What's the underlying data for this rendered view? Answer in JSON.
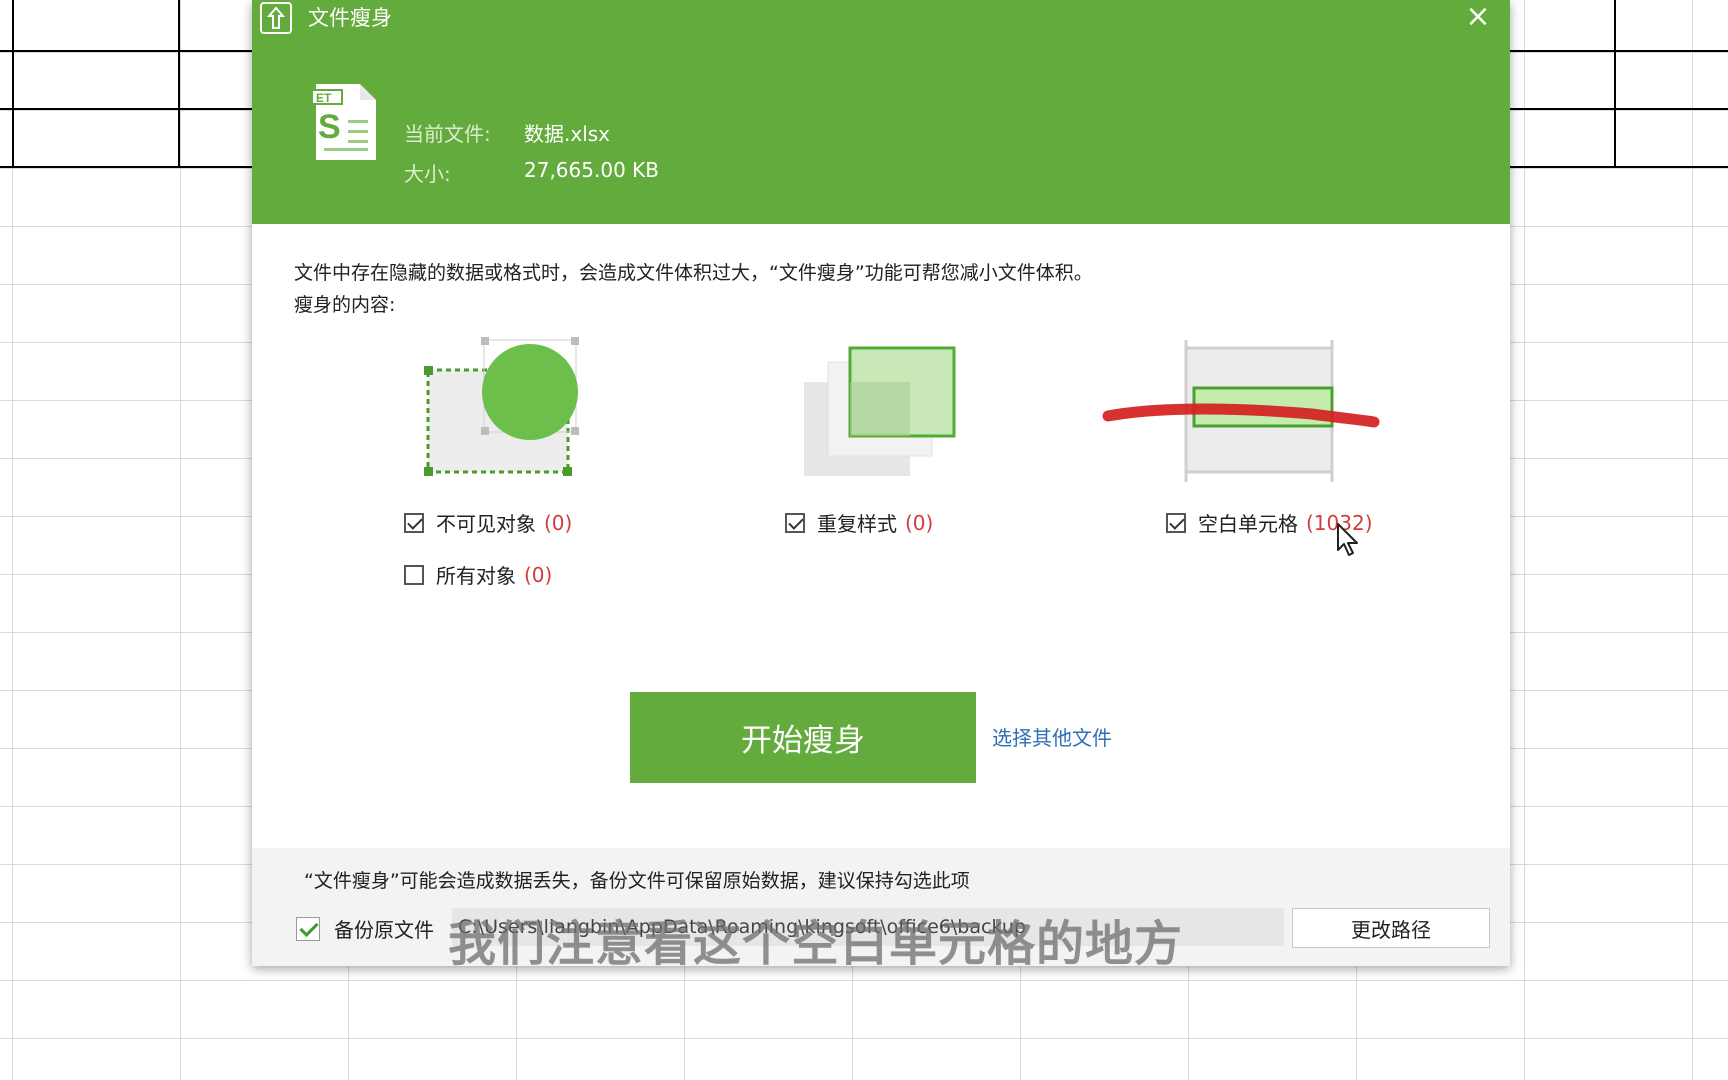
{
  "dialog": {
    "title": "文件瘦身",
    "close_symbol": "×",
    "file_label": "当前文件:",
    "file_name": "数据.xlsx",
    "size_label": "大小:",
    "size_value": "27,665.00 KB",
    "description": "文件中存在隐藏的数据或格式时，会造成文件体积过大，“文件瘦身”功能可帮您减小文件体积。",
    "content_label": "瘦身的内容:",
    "options": [
      {
        "label": "不可见对象",
        "count": "(0)",
        "checked": true
      },
      {
        "label": "所有对象",
        "count": "(0)",
        "checked": false
      },
      {
        "label": "重复样式",
        "count": "(0)",
        "checked": true
      },
      {
        "label": "空白单元格",
        "count": "(1032)",
        "checked": true
      }
    ],
    "start_button": "开始瘦身",
    "other_file_link": "选择其他文件",
    "warning": "“文件瘦身”可能会造成数据丢失，备份文件可保留原始数据，建议保持勾选此项",
    "backup_label": "备份原文件",
    "backup_checked": true,
    "backup_path": "C:\\Users\\liangbin\\AppData\\Roaming\\kingsoft\\office6\\backup",
    "change_path_button": "更改路径"
  },
  "subtitle": "我们注意看这个空白单元格的地方",
  "colors": {
    "accent": "#63ab3d",
    "count_red": "#d23c3c",
    "link_blue": "#2f6fb5"
  },
  "icons": {
    "app": "slim-app-icon",
    "file": "et-spreadsheet-file-icon",
    "close": "close-icon"
  }
}
